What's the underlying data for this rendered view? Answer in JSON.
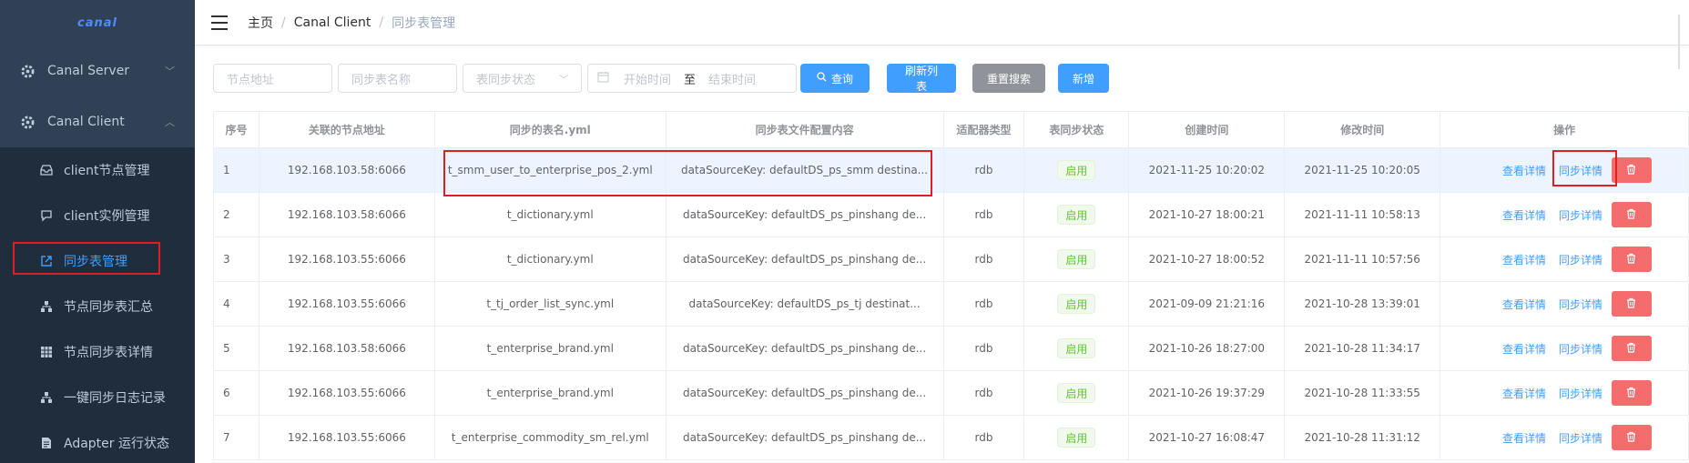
{
  "sidebar": {
    "logo": "canal",
    "menus": [
      {
        "label": "Canal Server",
        "expanded": false
      },
      {
        "label": "Canal Client",
        "expanded": true
      }
    ],
    "sub_items": [
      {
        "label": "client节点管理",
        "icon": "inbox-icon"
      },
      {
        "label": "client实例管理",
        "icon": "chat-icon"
      },
      {
        "label": "同步表管理",
        "icon": "external-link-icon",
        "active": true
      },
      {
        "label": "节点同步表汇总",
        "icon": "tree-icon"
      },
      {
        "label": "节点同步表详情",
        "icon": "grid-icon"
      },
      {
        "label": "一键同步日志记录",
        "icon": "tree-icon"
      },
      {
        "label": "Adapter 运行状态",
        "icon": "document-icon"
      }
    ]
  },
  "header": {
    "breadcrumb": [
      "主页",
      "Canal Client",
      "同步表管理"
    ]
  },
  "filters": {
    "node_placeholder": "节点地址",
    "table_name_placeholder": "同步表名称",
    "status_placeholder": "表同步状态",
    "start_placeholder": "开始时间",
    "range_sep": "至",
    "end_placeholder": "结束时间",
    "query": "查询",
    "refresh": "刷新列表",
    "reset": "重置搜索",
    "add": "新增"
  },
  "table": {
    "columns": [
      "序号",
      "关联的节点地址",
      "同步的表名.yml",
      "同步表文件配置内容",
      "适配器类型",
      "表同步状态",
      "创建时间",
      "修改时间",
      "操作"
    ],
    "rows": [
      {
        "idx": "1",
        "node": "192.168.103.58:6066",
        "yml": "t_smm_user_to_enterprise_pos_2.yml",
        "content": "dataSourceKey: defaultDS_ps_smm destina...",
        "type": "rdb",
        "status": "启用",
        "created": "2021-11-25 10:20:02",
        "modified": "2021-11-25 10:20:05"
      },
      {
        "idx": "2",
        "node": "192.168.103.58:6066",
        "yml": "t_dictionary.yml",
        "content": "dataSourceKey: defaultDS_ps_pinshang de...",
        "type": "rdb",
        "status": "启用",
        "created": "2021-10-27 18:00:21",
        "modified": "2021-11-11 10:58:13"
      },
      {
        "idx": "3",
        "node": "192.168.103.55:6066",
        "yml": "t_dictionary.yml",
        "content": "dataSourceKey: defaultDS_ps_pinshang de...",
        "type": "rdb",
        "status": "启用",
        "created": "2021-10-27 18:00:52",
        "modified": "2021-11-11 10:57:56"
      },
      {
        "idx": "4",
        "node": "192.168.103.55:6066",
        "yml": "t_tj_order_list_sync.yml",
        "content": "dataSourceKey: defaultDS_ps_tj destinat...",
        "type": "rdb",
        "status": "启用",
        "created": "2021-09-09 21:21:16",
        "modified": "2021-10-28 13:39:01"
      },
      {
        "idx": "5",
        "node": "192.168.103.58:6066",
        "yml": "t_enterprise_brand.yml",
        "content": "dataSourceKey: defaultDS_ps_pinshang de...",
        "type": "rdb",
        "status": "启用",
        "created": "2021-10-26 18:27:00",
        "modified": "2021-10-28 11:34:17"
      },
      {
        "idx": "6",
        "node": "192.168.103.55:6066",
        "yml": "t_enterprise_brand.yml",
        "content": "dataSourceKey: defaultDS_ps_pinshang de...",
        "type": "rdb",
        "status": "启用",
        "created": "2021-10-26 19:37:29",
        "modified": "2021-10-28 11:33:55"
      },
      {
        "idx": "7",
        "node": "192.168.103.55:6066",
        "yml": "t_enterprise_commodity_sm_rel.yml",
        "content": "dataSourceKey: defaultDS_ps_pinshang de...",
        "type": "rdb",
        "status": "启用",
        "created": "2021-10-27 16:08:47",
        "modified": "2021-10-28 11:31:12"
      }
    ],
    "actions": {
      "view": "查看详情",
      "sync": "同步详情"
    }
  },
  "colors": {
    "sidebar_bg": "#304156",
    "primary": "#409eff",
    "danger": "#f56c6c",
    "success": "#67c23a",
    "highlight_box": "#e02020"
  }
}
